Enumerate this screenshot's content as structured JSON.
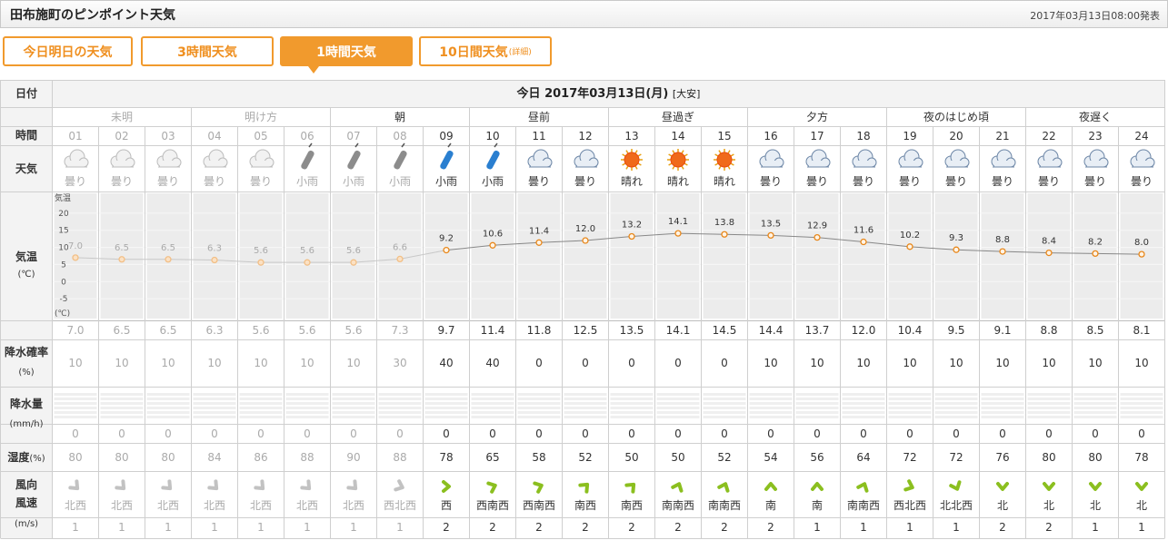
{
  "header": {
    "title": "田布施町のピンポイント天気",
    "issued": "2017年03月13日08:00発表"
  },
  "tabs": [
    {
      "label": "今日明日の天気",
      "sub": "",
      "active": false
    },
    {
      "label": "3時間天気",
      "sub": "",
      "active": false
    },
    {
      "label": "1時間天気",
      "sub": "",
      "active": true
    },
    {
      "label": "10日間天気",
      "sub": "(詳細)",
      "active": false
    }
  ],
  "date_row": {
    "label": "日付",
    "today": "今日 2017年03月13日(月)",
    "rokuyo": "[大安]"
  },
  "row_labels": {
    "time": "時間",
    "weather": "天気",
    "temp": "気温",
    "temp_unit": "(℃)",
    "precip_prob": "降水確率",
    "precip_prob_unit": "(%)",
    "precip_amount": "降水量",
    "precip_amount_unit": "(mm/h)",
    "humidity": "湿度",
    "humidity_unit": "(%)",
    "wind_dir": "風向",
    "wind_speed": "風速",
    "wind_unit": "(m/s)"
  },
  "temp_axis": {
    "title": "気温",
    "unit": "(℃)",
    "ticks": [
      "20",
      "15",
      "10",
      "5",
      "0",
      "-5"
    ],
    "range": [
      -10,
      25
    ]
  },
  "periods": [
    {
      "label": "未明",
      "span": 3
    },
    {
      "label": "明け方",
      "span": 3
    },
    {
      "label": "朝",
      "span": 3
    },
    {
      "label": "昼前",
      "span": 3
    },
    {
      "label": "昼過ぎ",
      "span": 3
    },
    {
      "label": "夕方",
      "span": 3
    },
    {
      "label": "夜のはじめ頃",
      "span": 3
    },
    {
      "label": "夜遅く",
      "span": 3
    }
  ],
  "hours": [
    "01",
    "02",
    "03",
    "04",
    "05",
    "06",
    "07",
    "08",
    "09",
    "10",
    "11",
    "12",
    "13",
    "14",
    "15",
    "16",
    "17",
    "18",
    "19",
    "20",
    "21",
    "22",
    "23",
    "24"
  ],
  "past_hours": 8,
  "weather_text": [
    "曇り",
    "曇り",
    "曇り",
    "曇り",
    "曇り",
    "小雨",
    "小雨",
    "小雨",
    "小雨",
    "小雨",
    "曇り",
    "曇り",
    "晴れ",
    "晴れ",
    "晴れ",
    "曇り",
    "曇り",
    "曇り",
    "曇り",
    "曇り",
    "曇り",
    "曇り",
    "曇り",
    "曇り"
  ],
  "weather_icon": [
    "cloud-icon",
    "cloud-icon",
    "cloud-icon",
    "cloud-icon",
    "cloud-icon",
    "umbrella-icon",
    "umbrella-icon",
    "umbrella-icon",
    "umbrella-icon",
    "umbrella-icon",
    "cloud-icon",
    "cloud-icon",
    "sun-icon",
    "sun-icon",
    "sun-icon",
    "cloud-icon",
    "cloud-icon",
    "cloud-icon",
    "cloud-icon",
    "cloud-icon",
    "cloud-icon",
    "cloud-icon",
    "cloud-icon",
    "cloud-icon"
  ],
  "chart_data": {
    "type": "line",
    "x": [
      "01",
      "02",
      "03",
      "04",
      "05",
      "06",
      "07",
      "08",
      "09",
      "10",
      "11",
      "12",
      "13",
      "14",
      "15",
      "16",
      "17",
      "18",
      "19",
      "20",
      "21",
      "22",
      "23",
      "24"
    ],
    "series": [
      {
        "values": [
          7.0,
          6.5,
          6.5,
          6.3,
          5.6,
          5.6,
          5.6,
          6.6,
          9.2,
          10.6,
          11.4,
          12.0,
          13.2,
          14.1,
          13.8,
          13.5,
          12.9,
          11.6,
          10.2,
          9.3,
          8.8,
          8.4,
          8.2,
          8.0
        ]
      }
    ],
    "ylim": [
      -10,
      25
    ],
    "yticks": [
      -5,
      0,
      5,
      10,
      15,
      20
    ]
  },
  "temp_values": [
    "7.0",
    "6.5",
    "6.5",
    "6.3",
    "5.6",
    "5.6",
    "5.6",
    "7.3",
    "9.7",
    "11.4",
    "11.8",
    "12.5",
    "13.5",
    "14.1",
    "14.5",
    "14.4",
    "13.7",
    "12.0",
    "10.4",
    "9.5",
    "9.1",
    "8.8",
    "8.5",
    "8.1"
  ],
  "precip_prob": [
    "10",
    "10",
    "10",
    "10",
    "10",
    "10",
    "10",
    "30",
    "40",
    "40",
    "0",
    "0",
    "0",
    "0",
    "0",
    "10",
    "10",
    "10",
    "10",
    "10",
    "10",
    "10",
    "10",
    "10"
  ],
  "precip_amount": [
    "0",
    "0",
    "0",
    "0",
    "0",
    "0",
    "0",
    "0",
    "0",
    "0",
    "0",
    "0",
    "0",
    "0",
    "0",
    "0",
    "0",
    "0",
    "0",
    "0",
    "0",
    "0",
    "0",
    "0"
  ],
  "humidity": [
    "80",
    "80",
    "80",
    "84",
    "86",
    "88",
    "90",
    "88",
    "78",
    "65",
    "58",
    "52",
    "50",
    "50",
    "52",
    "54",
    "56",
    "64",
    "72",
    "72",
    "76",
    "80",
    "80",
    "78"
  ],
  "wind_dir": [
    "北西",
    "北西",
    "北西",
    "北西",
    "北西",
    "北西",
    "北西",
    "西北西",
    "西",
    "西南西",
    "西南西",
    "南西",
    "南西",
    "南南西",
    "南南西",
    "南",
    "南",
    "南南西",
    "西北西",
    "北北西",
    "北",
    "北",
    "北",
    "北"
  ],
  "wind_speed": [
    "1",
    "1",
    "1",
    "1",
    "1",
    "1",
    "1",
    "1",
    "2",
    "2",
    "2",
    "2",
    "2",
    "2",
    "2",
    "2",
    "1",
    "1",
    "1",
    "1",
    "2",
    "2",
    "1",
    "1"
  ],
  "colors": {
    "accent": "#f19a2d",
    "past_text": "#aaaaaa",
    "grid": "#cfcfcf",
    "wind_arrow": "#8bbf1f",
    "rain_icon": "#2a7fd0"
  }
}
